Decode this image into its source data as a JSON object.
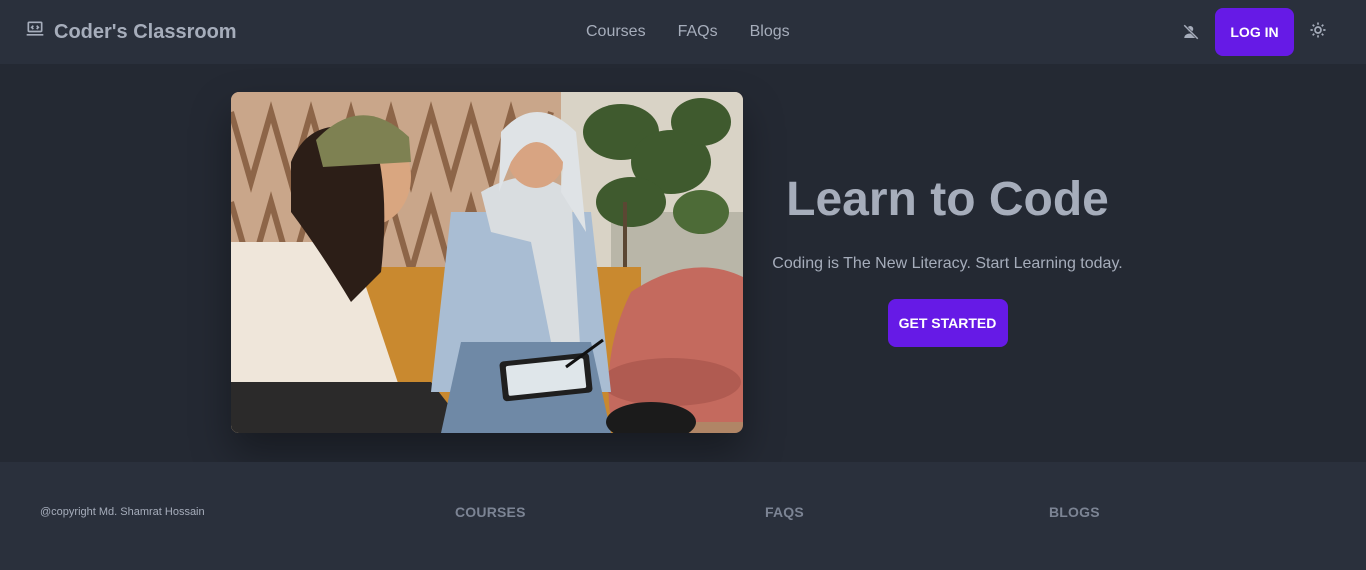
{
  "navbar": {
    "brand": "Coder's Classroom",
    "links": [
      "Courses",
      "FAQs",
      "Blogs"
    ],
    "login_label": "LOG IN"
  },
  "hero": {
    "title": "Learn to Code",
    "subtitle": "Coding is The New Literacy. Start Learning today.",
    "cta_label": "GET STARTED"
  },
  "footer": {
    "copyright": "@copyright Md. Shamrat Hossain",
    "sections": [
      "COURSES",
      "FAQS",
      "BLOGS"
    ]
  },
  "colors": {
    "primary": "#661ae6",
    "nav_bg": "#2a303c",
    "hero_bg": "#242933",
    "text": "#a6adbb"
  },
  "icons": {
    "brand": "laptop-code-icon",
    "user": "user-slash-icon",
    "theme": "sun-icon"
  }
}
